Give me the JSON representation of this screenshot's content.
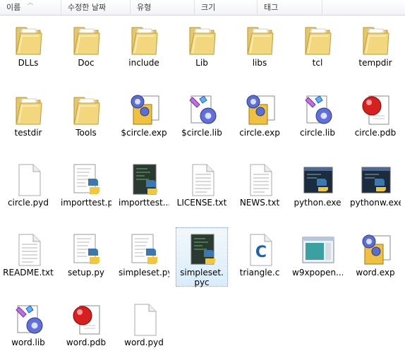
{
  "columns": [
    "이름",
    "수정한 날짜",
    "유형",
    "크기",
    "태그"
  ],
  "items": [
    {
      "label": "DLLs",
      "icon": "folder-icon"
    },
    {
      "label": "Doc",
      "icon": "folder-icon"
    },
    {
      "label": "include",
      "icon": "folder-icon"
    },
    {
      "label": "Lib",
      "icon": "folder-icon"
    },
    {
      "label": "libs",
      "icon": "folder-icon"
    },
    {
      "label": "tcl",
      "icon": "folder-icon"
    },
    {
      "label": "tempdir",
      "icon": "folder-icon"
    },
    {
      "label": "testdir",
      "icon": "folder-icon"
    },
    {
      "label": "Tools",
      "icon": "folder-icon"
    },
    {
      "label": "$circle.exp",
      "icon": "exp-file-icon"
    },
    {
      "label": "$circle.lib",
      "icon": "lib-file-icon"
    },
    {
      "label": "circle.exp",
      "icon": "exp-file-icon"
    },
    {
      "label": "circle.lib",
      "icon": "lib-file-icon"
    },
    {
      "label": "circle.pdb",
      "icon": "pdb-file-icon"
    },
    {
      "label": "circle.pyd",
      "icon": "blank-file-icon"
    },
    {
      "label": "importtest.py",
      "icon": "python-script-icon"
    },
    {
      "label": "importtest....",
      "icon": "python-compiled-icon"
    },
    {
      "label": "LICENSE.txt",
      "icon": "text-file-icon"
    },
    {
      "label": "NEWS.txt",
      "icon": "text-file-icon"
    },
    {
      "label": "python.exe",
      "icon": "python-exe-icon"
    },
    {
      "label": "pythonw.exe",
      "icon": "python-exe-icon"
    },
    {
      "label": "README.txt",
      "icon": "text-file-icon"
    },
    {
      "label": "setup.py",
      "icon": "python-script-icon"
    },
    {
      "label": "simpleset.py",
      "icon": "python-script-icon"
    },
    {
      "label": "simpleset.pyc",
      "icon": "python-compiled-icon",
      "selected": true
    },
    {
      "label": "triangle.c",
      "icon": "c-file-icon"
    },
    {
      "label": "w9xpopen....",
      "icon": "window-exe-icon"
    },
    {
      "label": "word.exp",
      "icon": "exp-file-icon"
    },
    {
      "label": "word.lib",
      "icon": "lib-file-icon"
    },
    {
      "label": "word.pdb",
      "icon": "pdb-file-icon"
    },
    {
      "label": "word.pyd",
      "icon": "blank-file-icon"
    }
  ]
}
